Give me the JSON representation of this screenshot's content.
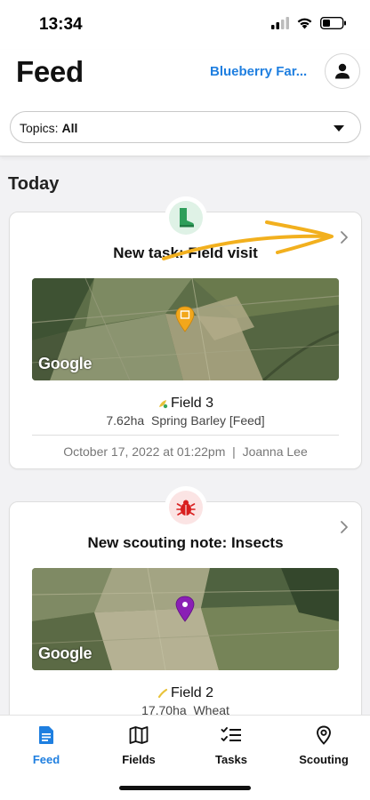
{
  "status_bar": {
    "time": "13:34"
  },
  "header": {
    "title": "Feed",
    "farm_name": "Blueberry Far...",
    "topics_prefix": "Topics:",
    "topics_value": "All"
  },
  "section": {
    "title": "Today"
  },
  "cards": [
    {
      "title": "New task: Field visit",
      "badge_icon": "boot-icon",
      "badge_color": "#2e9e5a",
      "field_name": "Field 3",
      "area": "7.62ha",
      "crop": "Spring Barley [Feed]",
      "date": "October 17, 2022 at 01:22pm",
      "separator": "|",
      "author": "Joanna Lee",
      "map_label": "Google",
      "pin_color": "#f2a71b"
    },
    {
      "title": "New scouting note: Insects",
      "badge_icon": "bug-icon",
      "badge_color": "#d92020",
      "field_name": "Field 2",
      "area": "17.70ha",
      "crop": "Wheat",
      "map_label": "Google",
      "pin_color": "#8a1fb5"
    }
  ],
  "nav": {
    "items": [
      {
        "label": "Feed",
        "icon": "document-icon",
        "active": true
      },
      {
        "label": "Fields",
        "icon": "map-icon",
        "active": false
      },
      {
        "label": "Tasks",
        "icon": "checklist-icon",
        "active": false
      },
      {
        "label": "Scouting",
        "icon": "location-pin-icon",
        "active": false
      }
    ]
  },
  "colors": {
    "accent": "#1f7fe0",
    "annotation_arrow": "#f2b01e"
  }
}
